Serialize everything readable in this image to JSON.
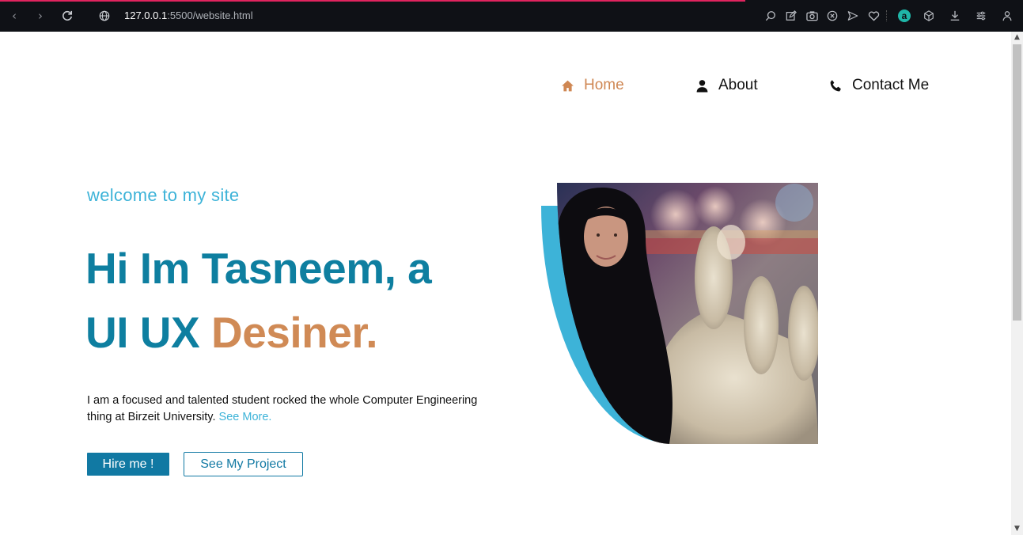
{
  "browser": {
    "url_host": "127.0.0.1",
    "url_path": ":5500/website.html",
    "back_icon": "chevron-left",
    "forward_icon": "chevron-right",
    "reload_icon": "reload",
    "site_info_icon": "globe",
    "toolbar_icons": [
      "zoom",
      "edit",
      "camera",
      "close-circle",
      "send",
      "heart",
      "ai-assistant",
      "box",
      "download",
      "settings",
      "profile"
    ],
    "brand_letter": "a"
  },
  "nav": {
    "items": [
      {
        "label": "Home",
        "icon": "home-icon",
        "active": true
      },
      {
        "label": "About",
        "icon": "user-icon",
        "active": false
      },
      {
        "label": "Contact Me",
        "icon": "phone-icon",
        "active": false
      }
    ]
  },
  "hero": {
    "welcome": "welcome to my site",
    "headline_line1": "Hi Im Tasneem, a",
    "headline_line2_prefix": "UI UX ",
    "headline_line2_accent": "Desiner.",
    "bio": "I am a focused and talented student rocked the whole Computer Engineering thing at Birzeit University.",
    "see_more": "See More.",
    "hire_button": "Hire me !",
    "project_button": "See My Project"
  },
  "colors": {
    "primary": "#0e7fa0",
    "accent": "#d08a55",
    "light_blue": "#3db3d8",
    "button_blue": "#1179a3",
    "chrome_bg": "#0f1116"
  }
}
